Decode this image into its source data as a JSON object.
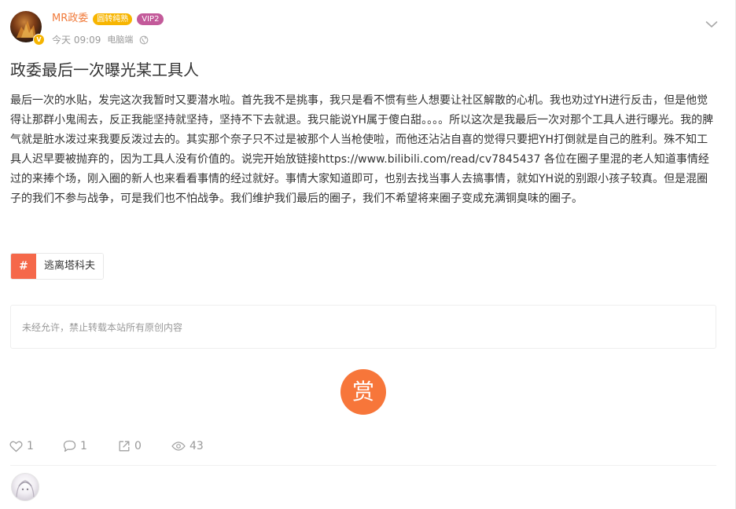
{
  "post": {
    "author": {
      "name": "MR政委",
      "badge_text": "圆转纯熟",
      "vip_text": "VIP2",
      "verified_glyph": "V"
    },
    "time": "今天 09:09",
    "client": "电脑端",
    "title": "政委最后一次曝光某工具人",
    "content": "最后一次的水贴，发完这次我暂时又要潜水啦。首先我不是挑事，我只是看不惯有些人想要让社区解散的心机。我也劝过YH进行反击，但是他觉得让那群小鬼闹去，反正我能坚持就坚持，坚持不下去就退。我只能说YH属于傻白甜。。。。所以这次是我最后一次对那个工具人进行曝光。我的脾气就是脏水泼过来我要反泼过去的。其实那个奈子只不过是被那个人当枪使啦，而他还沾沾自喜的觉得只要把YH打倒就是自己的胜利。殊不知工具人迟早要被抛弃的，因为工具人没有价值的。说完开始放链接https://www.bilibili.com/read/cv7845437 各位在圈子里混的老人知道事情经过的来捧个场，刚入圈的新人也来看看事情的经过就好。事情大家知道即可，也别去找当事人去搞事情，就如YH说的别跟小孩子较真。但是混圈子的我们不参与战争，可是我们也不怕战争。我们维护我们最后的圈子，我们不希望将来圈子变成充满铜臭味的圈子。",
    "tag": {
      "hash": "#",
      "label": "逃离塔科夫"
    },
    "copyright_notice": "未经允许，禁止转载本站所有原创内容",
    "reward_label": "赏",
    "stats": {
      "likes": "1",
      "comments": "1",
      "shares": "0",
      "views": "43"
    }
  },
  "colors": {
    "username": "#f07a3a",
    "badge_yellow": "#f7b500",
    "badge_vip": "#c35a9a",
    "tag_hash_bg": "#f5684a",
    "reward_bg": "#f7763a",
    "muted_text": "#999999",
    "body_text": "#333333"
  },
  "icons": {
    "menu": "chevron-down-icon",
    "visibility": "globe-icon",
    "like": "heart-icon",
    "comment": "comment-bubble-icon",
    "share": "share-icon",
    "views": "eye-icon"
  }
}
